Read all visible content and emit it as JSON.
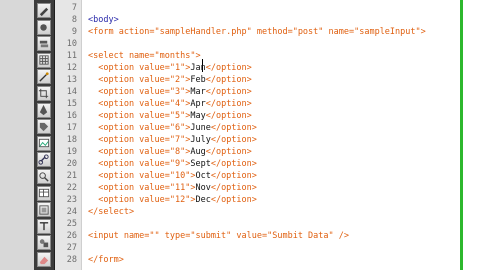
{
  "editor": {
    "colors": {
      "tag": "#e06010",
      "body_tag": "#2a2aaa",
      "text": "#111111",
      "gutter_bg": "#e6e6e6",
      "toolbar_bg": "#3c3c3c",
      "frame_accent": "#2db82d"
    },
    "toolbar_icons": [
      "pencil-icon",
      "brush-icon",
      "layers-icon",
      "grid-icon",
      "wand-icon",
      "crop-icon",
      "pen-icon",
      "tag-icon",
      "image-icon",
      "link-icon",
      "zoom-icon",
      "table-icon",
      "frame-icon",
      "text-icon",
      "shape-icon",
      "eraser-icon"
    ],
    "lines": [
      {
        "number": "7",
        "segments": []
      },
      {
        "number": "8",
        "segments": [
          {
            "t": "<body>",
            "c": "body"
          }
        ]
      },
      {
        "number": "9",
        "segments": [
          {
            "t": "<form action=\"sampleHandler.php\" method=\"post\" name=\"sampleInput\">",
            "c": "tag"
          }
        ]
      },
      {
        "number": "10",
        "segments": []
      },
      {
        "number": "11",
        "segments": [
          {
            "t": "<select name=\"months\">",
            "c": "tag"
          }
        ]
      },
      {
        "number": "12",
        "segments": [
          {
            "t": "  <option value=\"1\">",
            "c": "tag"
          },
          {
            "t": "Jan",
            "c": "text"
          },
          {
            "t": "</option>",
            "c": "tag"
          }
        ]
      },
      {
        "number": "13",
        "segments": [
          {
            "t": "  <option value=\"2\">",
            "c": "tag"
          },
          {
            "t": "Feb",
            "c": "text"
          },
          {
            "t": "</option>",
            "c": "tag"
          }
        ]
      },
      {
        "number": "14",
        "segments": [
          {
            "t": "  <option value=\"3\">",
            "c": "tag"
          },
          {
            "t": "Mar",
            "c": "text"
          },
          {
            "t": "</option>",
            "c": "tag"
          }
        ]
      },
      {
        "number": "15",
        "segments": [
          {
            "t": "  <option value=\"4\">",
            "c": "tag"
          },
          {
            "t": "Apr",
            "c": "text"
          },
          {
            "t": "</option>",
            "c": "tag"
          }
        ]
      },
      {
        "number": "16",
        "segments": [
          {
            "t": "  <option value=\"5\">",
            "c": "tag"
          },
          {
            "t": "May",
            "c": "text"
          },
          {
            "t": "</option>",
            "c": "tag"
          }
        ]
      },
      {
        "number": "17",
        "segments": [
          {
            "t": "  <option value=\"6\">",
            "c": "tag"
          },
          {
            "t": "June",
            "c": "text"
          },
          {
            "t": "</option>",
            "c": "tag"
          }
        ]
      },
      {
        "number": "18",
        "segments": [
          {
            "t": "  <option value=\"7\">",
            "c": "tag"
          },
          {
            "t": "July",
            "c": "text"
          },
          {
            "t": "</option>",
            "c": "tag"
          }
        ]
      },
      {
        "number": "19",
        "segments": [
          {
            "t": "  <option value=\"8\">",
            "c": "tag"
          },
          {
            "t": "Aug",
            "c": "text"
          },
          {
            "t": "</option>",
            "c": "tag"
          }
        ]
      },
      {
        "number": "20",
        "segments": [
          {
            "t": "  <option value=\"9\">",
            "c": "tag"
          },
          {
            "t": "Sept",
            "c": "text"
          },
          {
            "t": "</option>",
            "c": "tag"
          }
        ]
      },
      {
        "number": "21",
        "segments": [
          {
            "t": "  <option value=\"10\">",
            "c": "tag"
          },
          {
            "t": "Oct",
            "c": "text"
          },
          {
            "t": "</option>",
            "c": "tag"
          }
        ]
      },
      {
        "number": "22",
        "segments": [
          {
            "t": "  <option value=\"11\">",
            "c": "tag"
          },
          {
            "t": "Nov",
            "c": "text"
          },
          {
            "t": "</option>",
            "c": "tag"
          }
        ]
      },
      {
        "number": "23",
        "segments": [
          {
            "t": "  <option value=\"12\">",
            "c": "tag"
          },
          {
            "t": "Dec",
            "c": "text"
          },
          {
            "t": "</option>",
            "c": "tag"
          }
        ]
      },
      {
        "number": "24",
        "segments": [
          {
            "t": "</select>",
            "c": "tag"
          }
        ]
      },
      {
        "number": "25",
        "segments": []
      },
      {
        "number": "26",
        "segments": [
          {
            "t": "<input name=\"\" type=\"submit\" value=\"Sumbit Data\" />",
            "c": "tag"
          }
        ]
      },
      {
        "number": "27",
        "segments": []
      },
      {
        "number": "28",
        "segments": [
          {
            "t": "</form>",
            "c": "tag"
          }
        ]
      }
    ]
  }
}
